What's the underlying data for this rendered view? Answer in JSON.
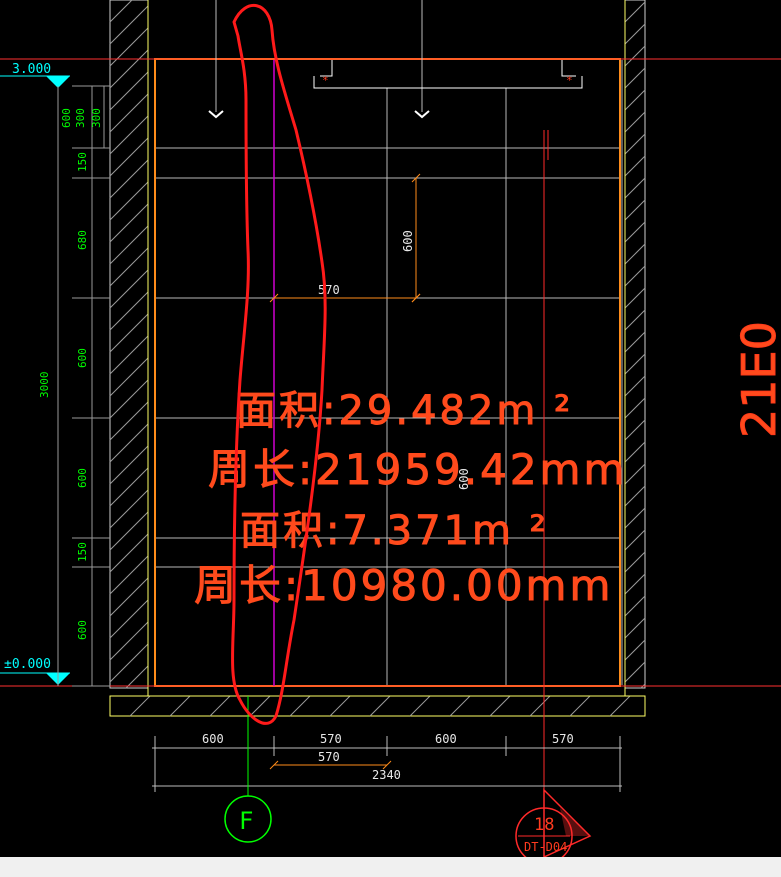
{
  "levels": {
    "top": "3.000",
    "bottom": "±0.000"
  },
  "left_dims": [
    "600",
    "300",
    "300",
    "150",
    "680",
    "600",
    "600",
    "150",
    "600"
  ],
  "left_total": "3000",
  "inner_dims": {
    "horizontal": "570",
    "vertical": "600",
    "vertical_lower": "600"
  },
  "bottom_dims": [
    "600",
    "570",
    "600",
    "570"
  ],
  "bottom_sub": "570",
  "bottom_total": "2340",
  "area_labels": [
    "面积:29.482m ²",
    "周长:21959.42mm",
    "面积:7.371m ²",
    "周长:10980.00mm"
  ],
  "grid_axis": "F",
  "section_ref": {
    "number": "18",
    "sheet": "DT-D04"
  },
  "side_text": "21E0",
  "colors": {
    "background": "#000000",
    "orange": "#ff8c1a",
    "yellow": "#ffff66",
    "green": "#00ff00",
    "red": "#ff2a2a",
    "magenta": "#d000d0",
    "cyan": "#00ffff",
    "markup": "#ff1a1a"
  }
}
